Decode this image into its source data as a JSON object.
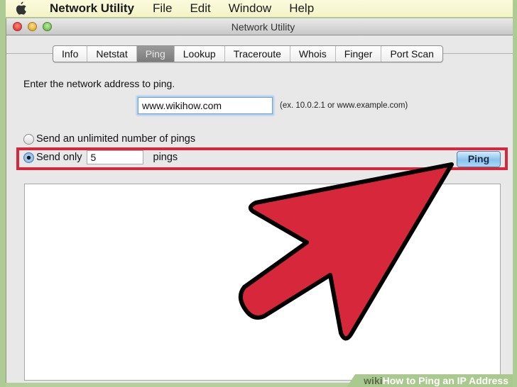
{
  "menubar": {
    "app_name": "Network Utility",
    "items": [
      "File",
      "Edit",
      "Window",
      "Help"
    ]
  },
  "window": {
    "title": "Network Utility",
    "tabs": [
      {
        "label": "Info",
        "active": false
      },
      {
        "label": "Netstat",
        "active": false
      },
      {
        "label": "Ping",
        "active": true
      },
      {
        "label": "Lookup",
        "active": false
      },
      {
        "label": "Traceroute",
        "active": false
      },
      {
        "label": "Whois",
        "active": false
      },
      {
        "label": "Finger",
        "active": false
      },
      {
        "label": "Port Scan",
        "active": false
      }
    ]
  },
  "ping": {
    "prompt": "Enter the network address to ping.",
    "address_value": "www.wikihow.com",
    "address_hint": "(ex. 10.0.2.1 or www.example.com)",
    "option_unlimited": "Send an unlimited number of pings",
    "option_limited": "Send only",
    "option_limited_selected": true,
    "count_value": "5",
    "count_suffix": "pings",
    "ping_button": "Ping",
    "output": ""
  },
  "annotation": {
    "highlight_color": "#d6283a",
    "arrow_fill": "#d6283a",
    "arrow_stroke": "#000000"
  },
  "watermark": {
    "brand": "wiki",
    "title": "How to Ping an IP Address"
  }
}
